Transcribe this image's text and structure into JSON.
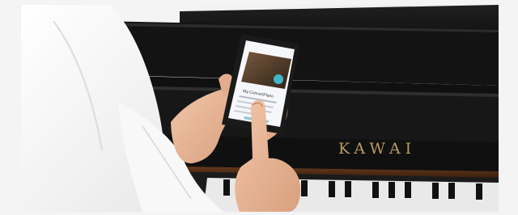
{
  "photo": {
    "piano_brand": "KAWAI",
    "phone_screen_title": "My ConcertPiano",
    "colors": {
      "piano_body": "#141414",
      "piano_wood": "#4a2a16",
      "brand_gold": "#b89a62",
      "shirt": "#f2f2f2",
      "skin": "#e8b899",
      "phone_frame": "#1a1a1a",
      "screen_bg": "#f6f7fb"
    },
    "icons": [
      "piano-icon",
      "hand-icon",
      "phone-icon"
    ]
  }
}
